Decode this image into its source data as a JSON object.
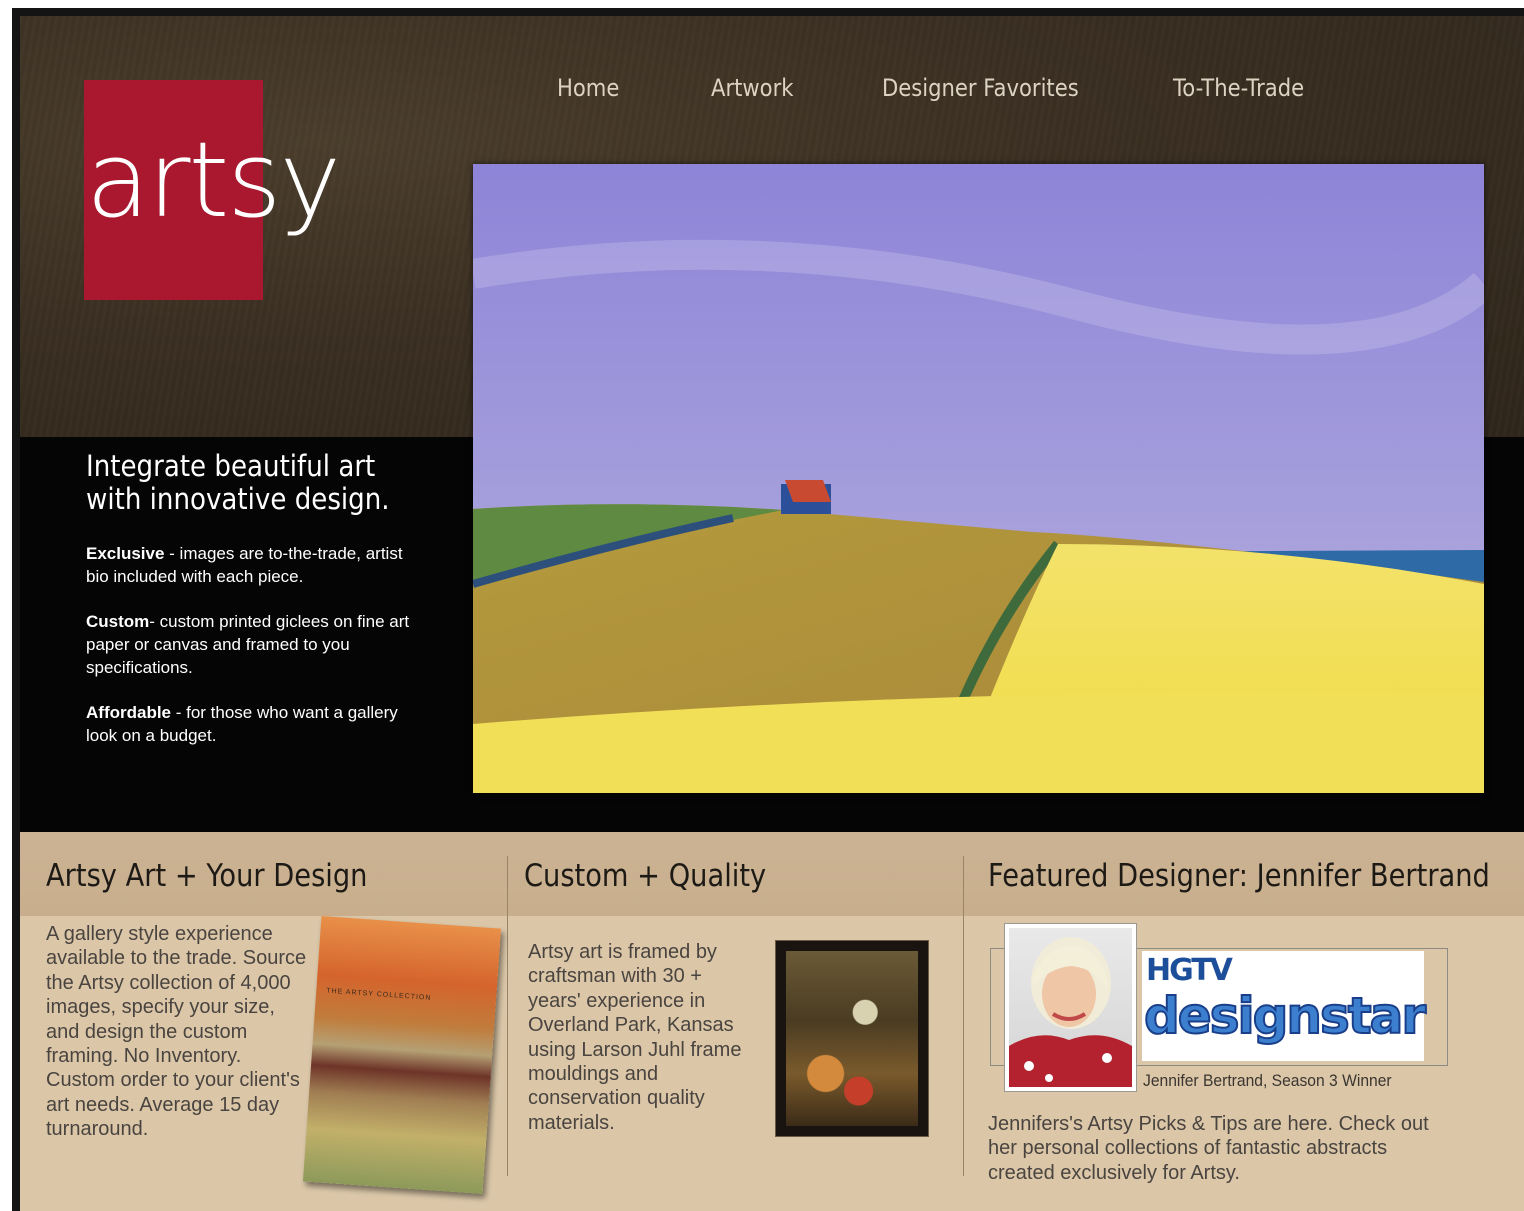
{
  "nav": {
    "home": "Home",
    "artwork": "Artwork",
    "designer_favorites": "Designer Favorites",
    "to_the_trade": "To-The-Trade"
  },
  "logo": {
    "text": "artsy",
    "color": "#a9182e"
  },
  "hero": {
    "tagline": "Integrate beautiful art with innovative design.",
    "features": [
      {
        "title": "Exclusive",
        "text": " - images are to-the-trade, artist bio included with each piece."
      },
      {
        "title": "Custom",
        "text": "- custom printed giclees on fine art paper or canvas and framed to you specifications."
      },
      {
        "title": "Affordable",
        "text": " - for those who want a gallery look on a budget."
      }
    ]
  },
  "columns": {
    "artsy": {
      "title": "Artsy Art + Your Design",
      "text": "A gallery style experience available to the trade. Source the Artsy collection of 4,000 images, specify your size, and design the custom framing. No Inventory. Custom order to your client's art needs. Average 15 day turnaround."
    },
    "custom": {
      "title": "Custom + Quality",
      "text": "Artsy art is framed by craftsman with 30 + years' experience in Overland Park, Kansas using Larson Juhl frame mouldings and conservation quality materials."
    },
    "featured": {
      "title": "Featured Designer: Jennifer Bertrand",
      "caption": "Jennifer Bertrand, Season 3 Winner",
      "text": "Jennifers's Artsy Picks & Tips are here. Check out her personal collections of fantastic abstracts created exclusively for Artsy.",
      "badge_top": "HGTV",
      "badge_word": "designstar"
    }
  }
}
